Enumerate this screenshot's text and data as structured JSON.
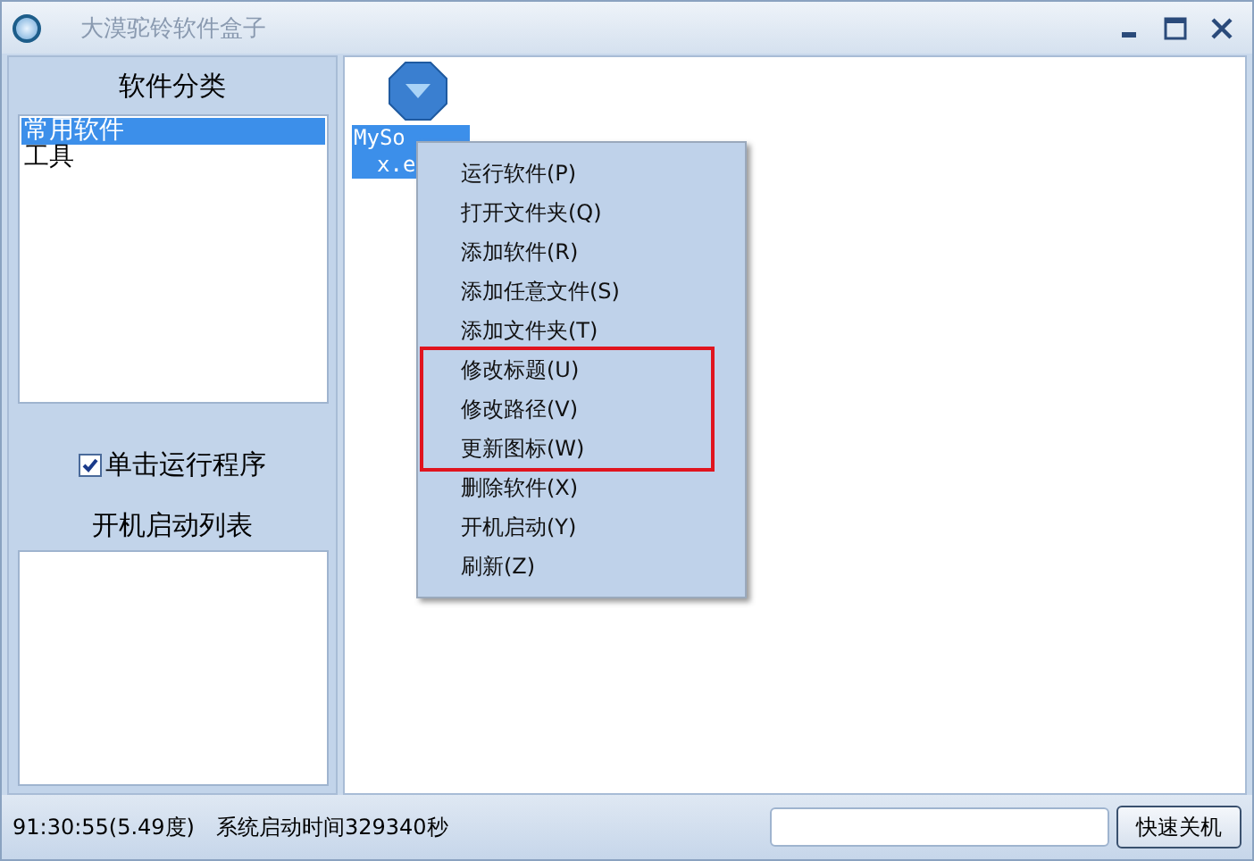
{
  "window": {
    "title": "大漠驼铃软件盒子"
  },
  "categories": {
    "heading": "软件分类",
    "items": [
      {
        "label": "常用软件",
        "selected": true
      },
      {
        "label": "工具",
        "selected": false
      }
    ]
  },
  "single_click": {
    "label": "单击运行程序",
    "checked": true
  },
  "startup": {
    "heading": "开机启动列表"
  },
  "files": [
    {
      "label_lines": [
        "MySo",
        "x.e"
      ],
      "selected": true
    }
  ],
  "context_menu": [
    {
      "label": "运行软件(P)",
      "highlighted": false
    },
    {
      "label": "打开文件夹(Q)",
      "highlighted": false
    },
    {
      "label": "添加软件(R)",
      "highlighted": false
    },
    {
      "label": "添加任意文件(S)",
      "highlighted": false
    },
    {
      "label": "添加文件夹(T)",
      "highlighted": false
    },
    {
      "label": "修改标题(U)",
      "highlighted": true
    },
    {
      "label": "修改路径(V)",
      "highlighted": true
    },
    {
      "label": "更新图标(W)",
      "highlighted": true
    },
    {
      "label": "删除软件(X)",
      "highlighted": false
    },
    {
      "label": "开机启动(Y)",
      "highlighted": false
    },
    {
      "label": "刷新(Z)",
      "highlighted": false
    }
  ],
  "status_bar": {
    "clock": "91:30:55(5.49度)",
    "uptime": "系统启动时间329340秒",
    "shutdown_button": "快速关机"
  }
}
